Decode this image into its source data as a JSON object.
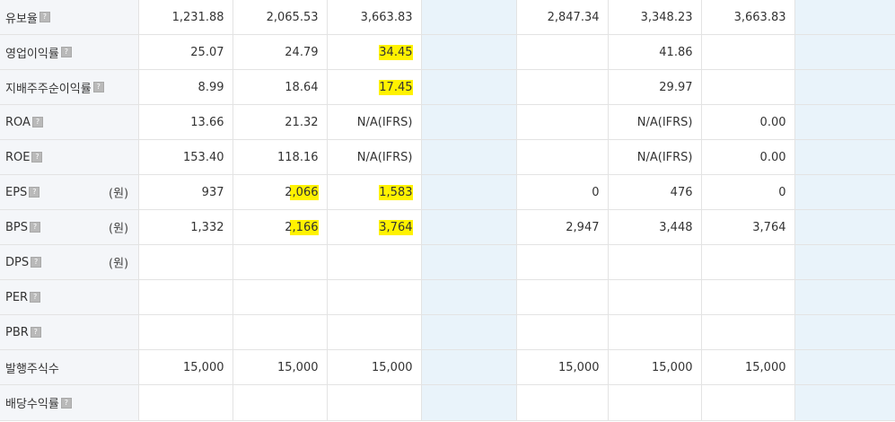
{
  "rows": [
    {
      "label": "유보율",
      "unit": "",
      "info": true,
      "values": [
        "1,231.88",
        "2,065.53",
        "3,663.83",
        "",
        "2,847.34",
        "3,348.23",
        "3,663.83",
        ""
      ],
      "hl": []
    },
    {
      "label": "영업이익률",
      "unit": "",
      "info": true,
      "values": [
        "25.07",
        "24.79",
        "34.45",
        "",
        "",
        "41.86",
        "",
        ""
      ],
      "hl": [
        2
      ]
    },
    {
      "label": "지배주주순이익률",
      "unit": "",
      "info": true,
      "values": [
        "8.99",
        "18.64",
        "17.45",
        "",
        "",
        "29.97",
        "",
        ""
      ],
      "hl": [
        2
      ]
    },
    {
      "label": "ROA",
      "unit": "",
      "info": true,
      "values": [
        "13.66",
        "21.32",
        "N/A(IFRS)",
        "",
        "",
        "N/A(IFRS)",
        "0.00",
        ""
      ],
      "hl": []
    },
    {
      "label": "ROE",
      "unit": "",
      "info": true,
      "values": [
        "153.40",
        "118.16",
        "N/A(IFRS)",
        "",
        "",
        "N/A(IFRS)",
        "0.00",
        ""
      ],
      "hl": []
    },
    {
      "label": "EPS",
      "unit": "(원)",
      "info": true,
      "values": [
        "937",
        "2,066",
        "1,583",
        "",
        "0",
        "476",
        "0",
        ""
      ],
      "hl": [
        1,
        2
      ]
    },
    {
      "label": "BPS",
      "unit": "(원)",
      "info": true,
      "values": [
        "1,332",
        "2,166",
        "3,764",
        "",
        "2,947",
        "3,448",
        "3,764",
        ""
      ],
      "hl": [
        1,
        2
      ]
    },
    {
      "label": "DPS",
      "unit": "(원)",
      "info": true,
      "values": [
        "",
        "",
        "",
        "",
        "",
        "",
        "",
        ""
      ],
      "hl": []
    },
    {
      "label": "PER",
      "unit": "",
      "info": true,
      "values": [
        "",
        "",
        "",
        "",
        "",
        "",
        "",
        ""
      ],
      "hl": []
    },
    {
      "label": "PBR",
      "unit": "",
      "info": true,
      "values": [
        "",
        "",
        "",
        "",
        "",
        "",
        "",
        ""
      ],
      "hl": []
    },
    {
      "label": "발행주식수",
      "unit": "",
      "info": false,
      "values": [
        "15,000",
        "15,000",
        "15,000",
        "",
        "15,000",
        "15,000",
        "15,000",
        ""
      ],
      "hl": []
    },
    {
      "label": "배당수익률",
      "unit": "",
      "info": true,
      "values": [
        "",
        "",
        "",
        "",
        "",
        "",
        "",
        ""
      ],
      "hl": []
    }
  ],
  "info_icon_text": "?"
}
